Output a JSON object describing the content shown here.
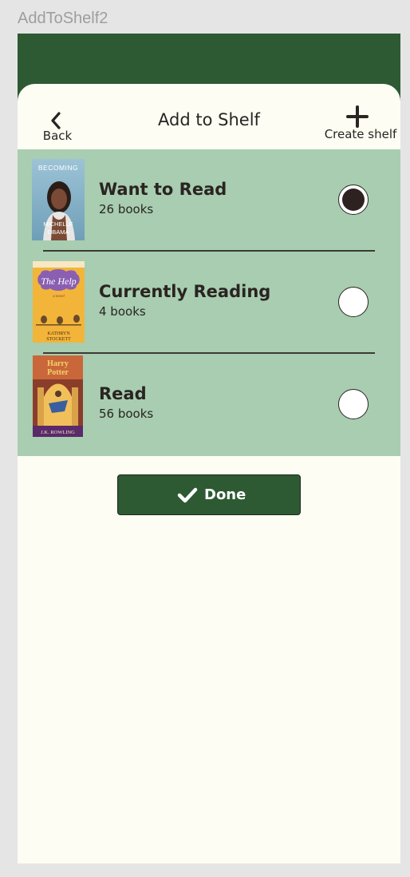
{
  "frame": {
    "label": "AddToShelf2"
  },
  "header": {
    "back_label": "Back",
    "title": "Add to Shelf",
    "create_label": "Create shelf"
  },
  "shelves": [
    {
      "name": "Want to Read",
      "count": "26 books",
      "selected": true,
      "cover": {
        "book_title_lines": [
          "BECOMING"
        ],
        "author_lines": [
          "MICHELLE",
          "OBAMA"
        ]
      }
    },
    {
      "name": "Currently Reading",
      "count": "4 books",
      "selected": false,
      "cover": {
        "book_title_lines": [
          "The Help"
        ],
        "subtitle": "a novel",
        "author_lines": [
          "KATHRYN",
          "STOCKETT"
        ]
      }
    },
    {
      "name": "Read",
      "count": "56 books",
      "selected": false,
      "cover": {
        "book_title_lines": [
          "Harry",
          "Potter"
        ],
        "author_lines": [
          "J.K. ROWLING"
        ]
      }
    }
  ],
  "done_label": "Done",
  "colors": {
    "brand_green": "#2d5a32",
    "list_green": "#a8cdb0",
    "sheet_bg": "#fdfdf3",
    "text_dark": "#2a2422"
  }
}
